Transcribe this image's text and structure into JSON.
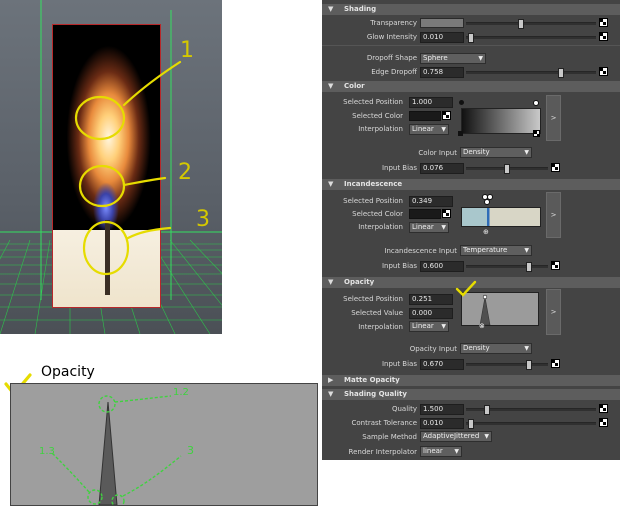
{
  "panel": {
    "shading": {
      "title": "Shading",
      "transparency_label": "Transparency",
      "glow_label": "Glow Intensity",
      "glow_value": "0.010",
      "dropoff_shape_label": "Dropoff Shape",
      "dropoff_shape_value": "Sphere",
      "edge_dropoff_label": "Edge Dropoff",
      "edge_dropoff_value": "0.758"
    },
    "color": {
      "title": "Color",
      "sel_pos_label": "Selected Position",
      "sel_pos_value": "1.000",
      "sel_color_label": "Selected Color",
      "interp_label": "Interpolation",
      "interp_value": "Linear",
      "input_label": "Color Input",
      "input_value": "Density",
      "bias_label": "Input Bias",
      "bias_value": "0.076"
    },
    "incandescence": {
      "title": "Incandescence",
      "sel_pos_label": "Selected Position",
      "sel_pos_value": "0.349",
      "sel_color_label": "Selected Color",
      "interp_label": "Interpolation",
      "interp_value": "Linear",
      "input_label": "Incandescence Input",
      "input_value": "Temperature",
      "bias_label": "Input Bias",
      "bias_value": "0.600"
    },
    "opacity": {
      "title": "Opacity",
      "sel_pos_label": "Selected Position",
      "sel_pos_value": "0.251",
      "sel_value_label": "Selected Value",
      "sel_value_value": "0.000",
      "interp_label": "Interpolation",
      "interp_value": "Linear",
      "input_label": "Opacity Input",
      "input_value": "Density",
      "bias_label": "Input Bias",
      "bias_value": "0.670"
    },
    "matte": {
      "title": "Matte Opacity"
    },
    "quality": {
      "title": "Shading Quality",
      "quality_label": "Quality",
      "quality_value": "1.500",
      "contrast_label": "Contrast Tolerance",
      "contrast_value": "0.010",
      "sample_label": "Sample Method",
      "sample_value": "AdaptiveJittered",
      "render_interp_label": "Render Interpolator",
      "render_interp_value": "linear"
    },
    "side_button": ">"
  },
  "annotations": {
    "viewport_numbers": [
      "1",
      "2",
      "3"
    ],
    "opacity_heading": "Opacity",
    "graph_numbers": [
      "1.2",
      "1.3",
      "3"
    ]
  },
  "colors": {
    "annotation_yellow": "#d9d000",
    "graph_green": "#3fd23f",
    "panel_bg": "#444444",
    "section_bg": "#5d5d5d",
    "incandescence_left": "#a9c7cc",
    "incandescence_right": "#d8d6c6"
  }
}
